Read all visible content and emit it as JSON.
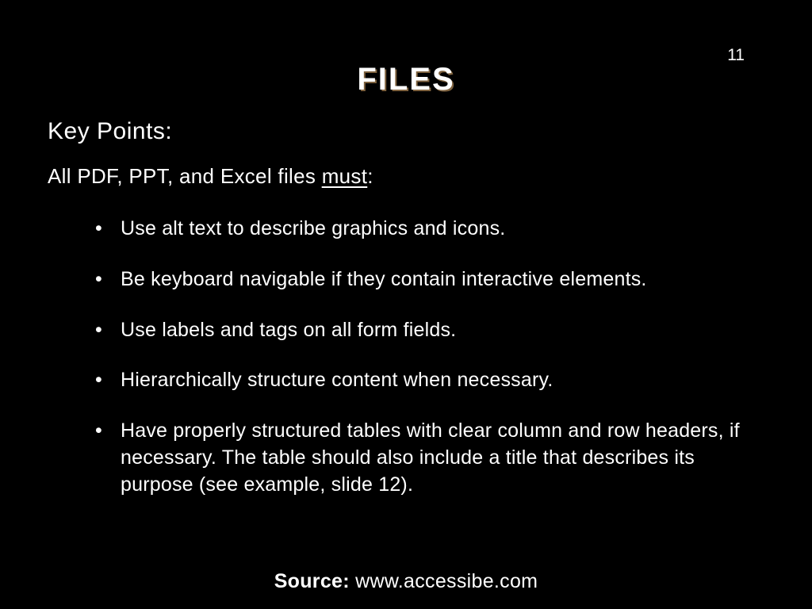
{
  "page_number": "11",
  "title": "FILES",
  "key_points_label": "Key Points:",
  "intro_prefix": "All PDF, PPT, and Excel files ",
  "intro_underline": "must",
  "intro_suffix": ":",
  "bullets": [
    "Use alt text to describe graphics and icons.",
    "Be keyboard navigable if they contain interactive elements.",
    "Use labels and tags on all form fields.",
    "Hierarchically structure content when necessary.",
    "Have properly structured tables with clear column and row headers, if necessary. The table should also include a title that describes its purpose (see example, slide 12)."
  ],
  "source_label": "Source:",
  "source_value": "www.accessibe.com"
}
